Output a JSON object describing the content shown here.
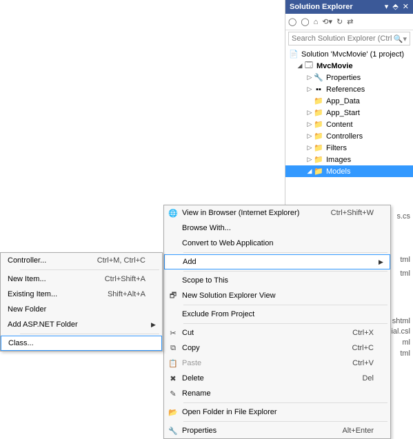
{
  "panel": {
    "title": "Solution Explorer",
    "searchPlaceholder": "Search Solution Explorer (Ctrl"
  },
  "tree": {
    "solution": "Solution 'MvcMovie' (1 project)",
    "project": "MvcMovie",
    "items": [
      {
        "label": "Properties",
        "expander": "▷"
      },
      {
        "label": "References",
        "expander": "▷"
      },
      {
        "label": "App_Data",
        "expander": ""
      },
      {
        "label": "App_Start",
        "expander": "▷"
      },
      {
        "label": "Content",
        "expander": "▷"
      },
      {
        "label": "Controllers",
        "expander": "▷"
      },
      {
        "label": "Filters",
        "expander": "▷"
      },
      {
        "label": "Images",
        "expander": "▷"
      },
      {
        "label": "Models",
        "expander": "◢",
        "selected": true
      }
    ],
    "partial": [
      "s.cs",
      "tml",
      "tml",
      "shtml",
      "ial.csl",
      "ml",
      "tml"
    ]
  },
  "contextMenu": {
    "items": [
      {
        "icon": "browser-icon",
        "label": "View in Browser (Internet Explorer)",
        "shortcut": "Ctrl+Shift+W"
      },
      {
        "label": "Browse With..."
      },
      {
        "label": "Convert to Web Application"
      },
      {
        "sep": true
      },
      {
        "label": "Add",
        "arrow": true,
        "highlight": true
      },
      {
        "sep": true
      },
      {
        "label": "Scope to This"
      },
      {
        "icon": "new-view-icon",
        "label": "New Solution Explorer View"
      },
      {
        "sep": true
      },
      {
        "label": "Exclude From Project"
      },
      {
        "sep": true
      },
      {
        "icon": "cut-icon",
        "label": "Cut",
        "shortcut": "Ctrl+X"
      },
      {
        "icon": "copy-icon",
        "label": "Copy",
        "shortcut": "Ctrl+C"
      },
      {
        "icon": "paste-icon",
        "label": "Paste",
        "shortcut": "Ctrl+V",
        "disabled": true
      },
      {
        "icon": "delete-icon",
        "label": "Delete",
        "shortcut": "Del"
      },
      {
        "icon": "rename-icon",
        "label": "Rename"
      },
      {
        "sep": true
      },
      {
        "icon": "folder-open-icon",
        "label": "Open Folder in File Explorer"
      },
      {
        "sep": true
      },
      {
        "icon": "properties-icon",
        "label": "Properties",
        "shortcut": "Alt+Enter"
      }
    ]
  },
  "subMenu": {
    "items": [
      {
        "label": "Controller...",
        "shortcut": "Ctrl+M, Ctrl+C"
      },
      {
        "sep": true
      },
      {
        "label": "New Item...",
        "shortcut": "Ctrl+Shift+A"
      },
      {
        "label": "Existing Item...",
        "shortcut": "Shift+Alt+A"
      },
      {
        "label": "New Folder"
      },
      {
        "label": "Add ASP.NET Folder",
        "arrow": true
      },
      {
        "sep": true
      },
      {
        "label": "Class...",
        "highlight": true
      }
    ]
  }
}
